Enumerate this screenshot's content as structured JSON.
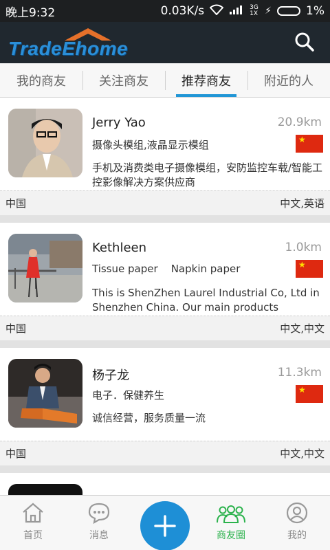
{
  "status": {
    "time": "晚上9:32",
    "network_speed": "0.03K/s",
    "network_type": "3G 1X",
    "battery": "1%"
  },
  "app": {
    "logo_text": "TradeEhome",
    "search_icon": "search-icon"
  },
  "tabs": [
    {
      "label": "我的商友",
      "active": false
    },
    {
      "label": "关注商友",
      "active": false
    },
    {
      "label": "推荐商友",
      "active": true
    },
    {
      "label": "附近的人",
      "active": false
    }
  ],
  "contacts": [
    {
      "name": "Jerry Yao",
      "distance": "20.9km",
      "tags": "摄像头模组,液晶显示模组",
      "description": "手机及消费类电子摄像模组，安防监控车载/智能工控影像解决方案供应商",
      "country": "中国",
      "languages": "中文,英语",
      "flag": "china-flag"
    },
    {
      "name": "Kethleen",
      "distance": "1.0km",
      "tags": "Tissue paper    Napkin paper",
      "description": "This is ShenZhen Laurel Industrial Co, Ltd in Shenzhen China. Our main products areTissu…",
      "country": "中国",
      "languages": "中文,中文",
      "flag": "china-flag"
    },
    {
      "name": "杨子龙",
      "distance": "11.3km",
      "tags": "电子．保健养生",
      "description": "诚信经营，服务质量一流",
      "country": "中国",
      "languages": "中文,中文",
      "flag": "china-flag"
    }
  ],
  "bottom_nav": [
    {
      "label": "首页",
      "icon": "home-icon",
      "active": false
    },
    {
      "label": "消息",
      "icon": "message-icon",
      "active": false
    },
    {
      "label": "",
      "icon": "plus-icon",
      "active": false
    },
    {
      "label": "商友圈",
      "icon": "people-icon",
      "active": true
    },
    {
      "label": "我的",
      "icon": "profile-icon",
      "active": false
    }
  ],
  "colors": {
    "accent": "#2196d6",
    "active_nav": "#2bb24c",
    "appbar": "#20282f",
    "flag_red": "#de2910"
  }
}
